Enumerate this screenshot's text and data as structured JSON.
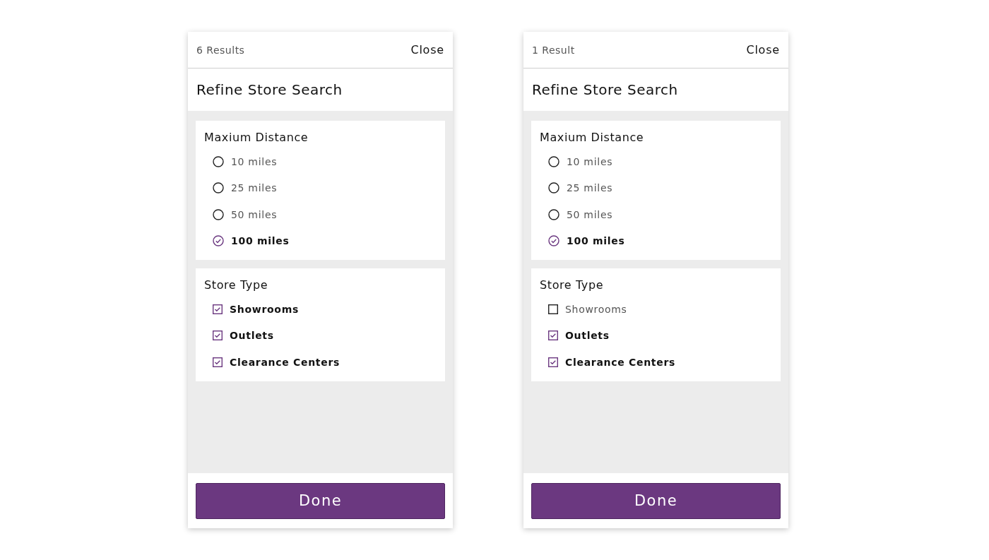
{
  "panels": [
    {
      "results": "6 Results",
      "close": "Close",
      "title": "Refine Store Search",
      "sections": [
        {
          "title": "Maxium Distance",
          "kind": "radio",
          "options": [
            {
              "label": "10 miles",
              "selected": false
            },
            {
              "label": "25 miles",
              "selected": false
            },
            {
              "label": "50 miles",
              "selected": false
            },
            {
              "label": "100 miles",
              "selected": true
            }
          ]
        },
        {
          "title": "Store Type",
          "kind": "checkbox",
          "options": [
            {
              "label": "Showrooms",
              "checked": true
            },
            {
              "label": "Outlets",
              "checked": true
            },
            {
              "label": "Clearance Centers",
              "checked": true
            }
          ]
        }
      ],
      "done": "Done"
    },
    {
      "results": "1 Result",
      "close": "Close",
      "title": "Refine Store Search",
      "sections": [
        {
          "title": "Maxium Distance",
          "kind": "radio",
          "options": [
            {
              "label": "10 miles",
              "selected": false
            },
            {
              "label": "25 miles",
              "selected": false
            },
            {
              "label": "50 miles",
              "selected": false
            },
            {
              "label": "100 miles",
              "selected": true
            }
          ]
        },
        {
          "title": "Store Type",
          "kind": "checkbox",
          "options": [
            {
              "label": "Showrooms",
              "checked": false
            },
            {
              "label": "Outlets",
              "checked": true
            },
            {
              "label": "Clearance Centers",
              "checked": true
            }
          ]
        }
      ],
      "done": "Done"
    }
  ]
}
